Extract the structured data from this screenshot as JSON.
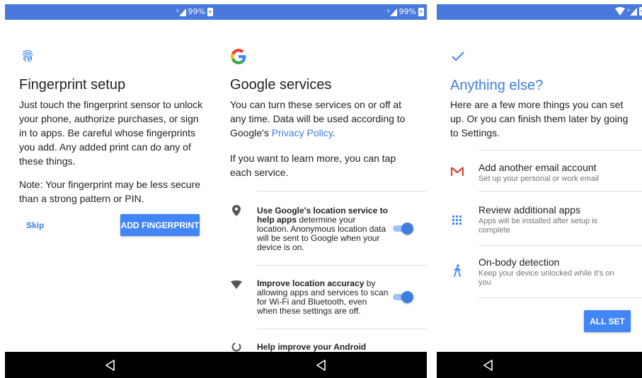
{
  "status_bar": {
    "left": {
      "battery_text": "99%"
    },
    "middle": {
      "battery_text": "99%"
    }
  },
  "fingerprint_screen": {
    "title": "Fingerprint setup",
    "description": "Just touch the fingerprint sensor to unlock your phone, authorize purchases, or sign in to apps. Be careful whose fingerprints you add. Any added print can do any of these things.",
    "note": "Note: Your fingerprint may be less secure than a strong pattern or PIN.",
    "skip_label": "Skip",
    "add_label": "ADD FINGERPRINT"
  },
  "google_services_screen": {
    "title": "Google services",
    "intro_before_link": "You can turn these services on or off at any time. Data will be used according to Google's ",
    "privacy_link": "Privacy Policy",
    "intro_after_link": ".",
    "learn_more": "If you want to learn more, you can tap each service.",
    "services": [
      {
        "bold": "Use Google's location service to help apps",
        "rest": " determine your location. Anonymous location data will be sent to Google when your device is on.",
        "enabled": true
      },
      {
        "bold": "Improve location accuracy",
        "rest": " by allowing apps and services to scan for Wi-Fi and Bluetooth, even when these settings are off.",
        "enabled": true
      },
      {
        "bold": "Help improve your Android",
        "rest": ""
      }
    ]
  },
  "anything_else_screen": {
    "title": "Anything else?",
    "description": "Here are a few more things you can set up. Or you can finish them later by going to Settings.",
    "items": [
      {
        "title": "Add another email account",
        "subtitle": "Set up your personal or work email",
        "icon": "gmail-icon"
      },
      {
        "title": "Review additional apps",
        "subtitle": "Apps will be installed after setup is complete",
        "icon": "apps-grid-icon"
      },
      {
        "title": "On-body detection",
        "subtitle": "Keep your device unlocked while it's on you",
        "icon": "walking-person-icon"
      }
    ],
    "all_set_label": "ALL SET"
  },
  "colors": {
    "status_bar": "#4a79de",
    "accent": "#4285f4",
    "link": "#3e7ee0",
    "gmail_red": "#db4437"
  }
}
